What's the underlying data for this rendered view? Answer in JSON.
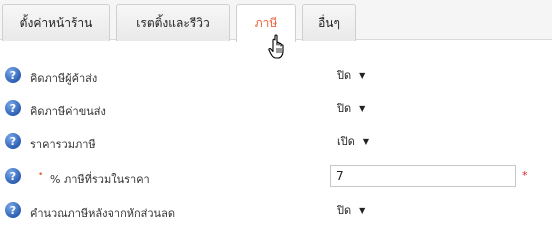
{
  "tabs": [
    {
      "label": "ตั้งค่าหน้าร้าน"
    },
    {
      "label": "เรตติ้งและรีวิว"
    },
    {
      "label": "ภาษี"
    },
    {
      "label": "อื่นๆ"
    }
  ],
  "active_tab_index": 2,
  "help_glyph": "?",
  "bullet_glyph": "•",
  "required_mark": "*",
  "dropdown_arrow": "▼",
  "rows": [
    {
      "label": "คิดภาษีผู้ค้าส่ง",
      "control": "select",
      "value": "ปิด"
    },
    {
      "label": "คิดภาษีค่าขนส่ง",
      "control": "select",
      "value": "ปิด"
    },
    {
      "label": "ราคารวมภาษี",
      "control": "select",
      "value": "เปิด"
    },
    {
      "label": "% ภาษีที่รวมในราคา",
      "control": "input",
      "value": "7"
    },
    {
      "label": "คำนวณภาษีหลังจากหักส่วนลด",
      "control": "select",
      "value": "ปิด"
    }
  ],
  "colors": {
    "accent": "#e8663b",
    "help_icon": "#2d5fb3",
    "required": "#d9241b",
    "tabbar_bg": "#f5f5f5"
  }
}
